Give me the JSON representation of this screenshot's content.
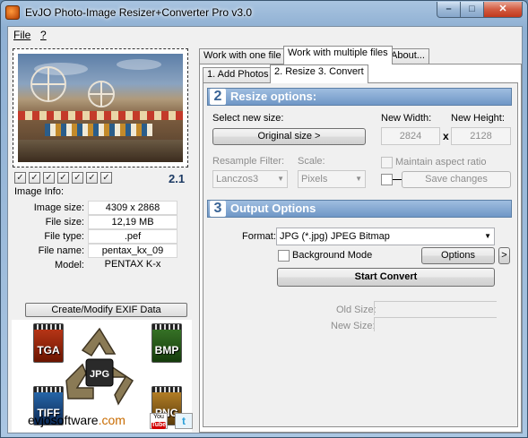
{
  "window": {
    "title": "EvJO Photo-Image Resizer+Converter Pro v3.0",
    "controls": {
      "minimize": "–",
      "maximize": "□",
      "close": "✕"
    }
  },
  "menu": {
    "file": "File",
    "help": "?"
  },
  "left": {
    "checkmarks": [
      "✓",
      "✓",
      "✓",
      "✓",
      "✓",
      "✓",
      "✓"
    ],
    "version": "2.1",
    "image_info": {
      "title": "Image Info:",
      "rows": [
        {
          "label": "Image size:",
          "value": "4309 x 2868"
        },
        {
          "label": "File size:",
          "value": "12,19 MB"
        },
        {
          "label": "File type:",
          "value": ".pef"
        },
        {
          "label": "File name:",
          "value": "pentax_kx_09"
        },
        {
          "label": "Model:",
          "value": "PENTAX K-x"
        }
      ]
    },
    "exif_button": "Create/Modify EXIF Data",
    "formats": {
      "tga": "TGA",
      "bmp": "BMP",
      "jpg": "JPG",
      "tiff": "TIFF",
      "png": "PNG"
    },
    "site": {
      "name": "evjosoftware",
      "tld": ".com"
    },
    "social": {
      "youtube_top": "You",
      "youtube_bottom": "Tube",
      "twitter": "t"
    }
  },
  "tabs": {
    "top": [
      "Work with one file",
      "Work with multiple files",
      "About..."
    ],
    "top_active": 1,
    "sub": [
      "1. Add Photos",
      "2. Resize 3. Convert"
    ],
    "sub_active": 1
  },
  "resize": {
    "number": "2",
    "title": "Resize options:",
    "select_label": "Select new size:",
    "original_size_button": "Original size >",
    "new_width_label": "New Width:",
    "new_height_label": "New Height:",
    "width": "2824",
    "height": "2128",
    "times": "x",
    "resample_label": "Resample Filter:",
    "resample_value": "Lanczos3",
    "scale_label": "Scale:",
    "scale_value": "Pixels",
    "maintain_aspect": "Maintain aspect ratio",
    "save_changes": "Save changes"
  },
  "output": {
    "number": "3",
    "title": "Output Options",
    "format_label": "Format:",
    "format_value": "JPG (*.jpg) JPEG Bitmap",
    "background_mode": "Background Mode",
    "options_button": "Options",
    "options_more": ">",
    "start_convert": "Start Convert",
    "old_size_label": "Old Size:",
    "new_size_label": "New Size:"
  },
  "status": {
    "dots": "..."
  },
  "colors": {
    "section_bar": "#6f97c6",
    "frame": "#8fb0d3",
    "close_button": "#c1381c",
    "site_tld": "#c86b00"
  }
}
